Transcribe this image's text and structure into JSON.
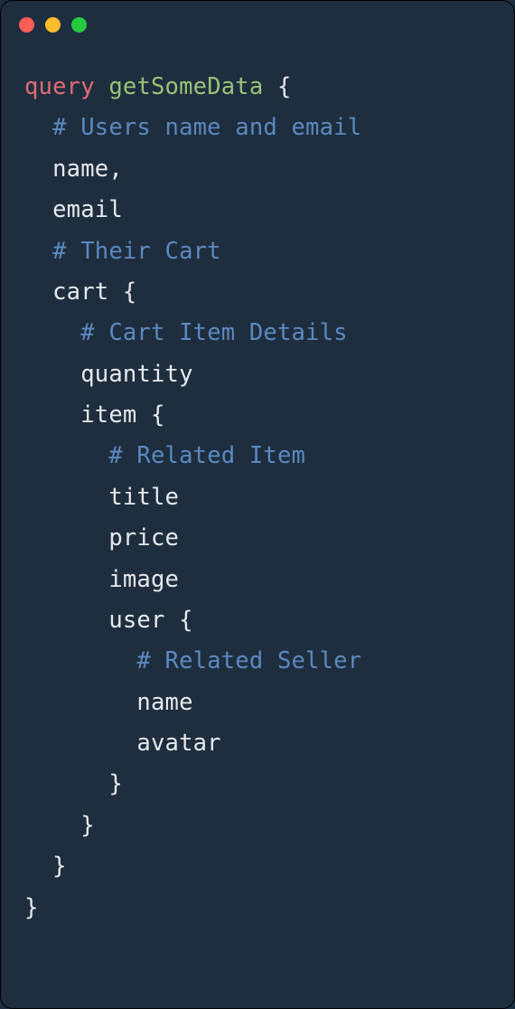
{
  "traffic_lights": [
    "red",
    "yellow",
    "green"
  ],
  "code": {
    "l1_kw": "query",
    "l1_fn": "getSomeData",
    "l1_brace": "{",
    "l2_comment": "# Users name and email",
    "l3": "name,",
    "l4": "email",
    "l5_comment": "# Their Cart",
    "l6": "cart {",
    "l7_comment": "# Cart Item Details",
    "l8": "quantity",
    "l9": "item {",
    "l10_comment": "# Related Item",
    "l11": "title",
    "l12": "price",
    "l13": "image",
    "l14": "user {",
    "l15_comment": "# Related Seller",
    "l16": "name",
    "l17": "avatar",
    "l18": "}",
    "l19": "}",
    "l20": "}",
    "l21": "}"
  }
}
